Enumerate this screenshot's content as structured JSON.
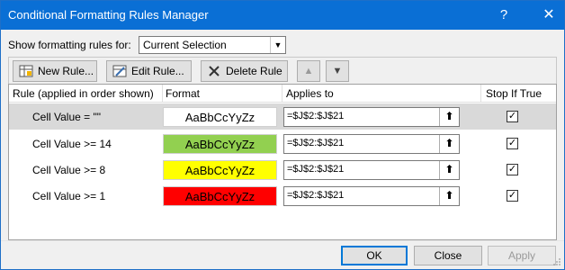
{
  "window": {
    "title": "Conditional Formatting Rules Manager",
    "help_glyph": "?",
    "close_glyph": "✕"
  },
  "show_rules": {
    "label": "Show formatting rules for:",
    "selected": "Current Selection"
  },
  "toolbar": {
    "new_rule": "New Rule...",
    "edit_rule": "Edit Rule...",
    "delete_rule": "Delete Rule",
    "move_up": "▲",
    "move_down": "▼"
  },
  "grid": {
    "headers": {
      "rule": "Rule (applied in order shown)",
      "format": "Format",
      "applies_to": "Applies to",
      "stop_if_true": "Stop If True"
    },
    "rows": [
      {
        "condition": "Cell Value = \"\"",
        "preview": "AaBbCcYyZz",
        "fill": "#ffffff",
        "applies_to": "=$J$2:$J$21",
        "stop": "✓"
      },
      {
        "condition": "Cell Value >= 14",
        "preview": "AaBbCcYyZz",
        "fill": "#92d050",
        "applies_to": "=$J$2:$J$21",
        "stop": "✓"
      },
      {
        "condition": "Cell Value >= 8",
        "preview": "AaBbCcYyZz",
        "fill": "#ffff00",
        "applies_to": "=$J$2:$J$21",
        "stop": "✓"
      },
      {
        "condition": "Cell Value >= 1",
        "preview": "AaBbCcYyZz",
        "fill": "#ff0000",
        "applies_to": "=$J$2:$J$21",
        "stop": "✓"
      }
    ],
    "collapse_glyph": "⬆"
  },
  "footer": {
    "ok": "OK",
    "close": "Close",
    "apply": "Apply"
  },
  "colors": {
    "title_bar": "#0a6fd5",
    "selection": "#d9d9d9",
    "ok_focus": "#0078d7"
  }
}
